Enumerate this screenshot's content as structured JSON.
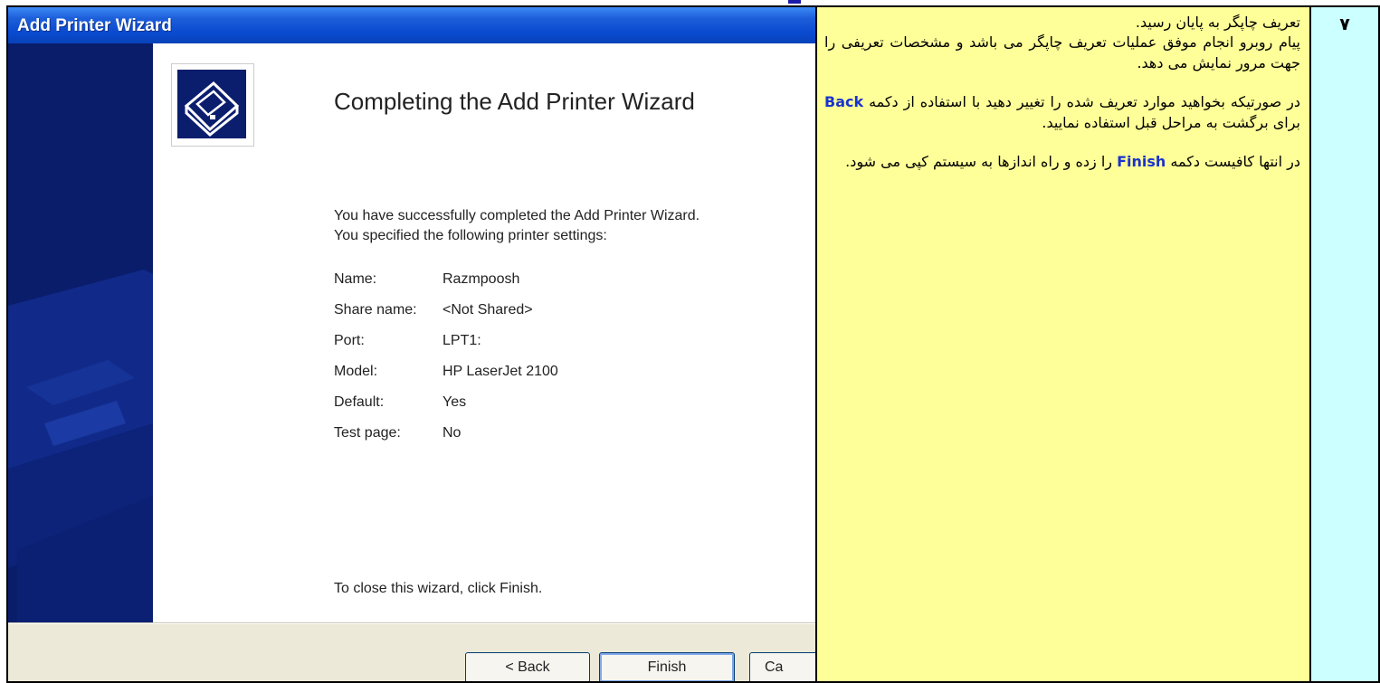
{
  "step_number": "۷",
  "description": {
    "para1_line1": "تعریف چاپگر به پایان رسید.",
    "para1_line2": "پیام روبرو انجام موفق عملیات تعریف چاپگر می باشد و مشخصات تعریفی را جهت مرور نمایش می دهد.",
    "para2_before": "در صورتیکه بخواهید موارد تعریف شده را تغییر دهید با استفاده از دکمه",
    "para2_kw": "Back",
    "para2_after": "برای برگشت به مراحل قبل استفاده نمایید.",
    "para3_before": "در انتها کافیست دکمه",
    "para3_kw": "Finish",
    "para3_after": "را زده و راه اندازها به سیستم کپی می شود."
  },
  "wizard": {
    "title": "Add Printer Wizard",
    "heading": "Completing the Add Printer Wizard",
    "intro_line1": "You have successfully completed the Add Printer Wizard.",
    "intro_line2": "You specified the following printer settings:",
    "settings": [
      {
        "label": "Name:",
        "value": "Razmpoosh"
      },
      {
        "label": "Share name:",
        "value": "<Not Shared>"
      },
      {
        "label": "Port:",
        "value": "LPT1:"
      },
      {
        "label": "Model:",
        "value": "HP LaserJet 2100"
      },
      {
        "label": "Default:",
        "value": "Yes"
      },
      {
        "label": "Test page:",
        "value": "No"
      }
    ],
    "closing": "To close this wizard, click Finish.",
    "back_button": "< Back",
    "finish_button": "Finish",
    "cancel_button": "Ca"
  },
  "icons": [
    "printer-icon",
    "printer-watermark-icon"
  ]
}
